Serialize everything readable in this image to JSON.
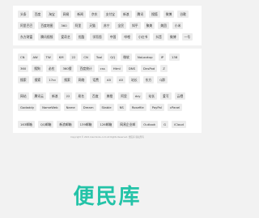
{
  "panels": [
    {
      "rows": [
        [
          "头条",
          "百度",
          "淘宝",
          "网易",
          "新闻",
          "京东",
          "支付宝",
          "新浪",
          "腾讯",
          "搜狐",
          "微博",
          "谷歌"
        ],
        [
          "阿里巴巴",
          "百度地图",
          "360",
          "阿里",
          "天猫",
          "苏宁",
          "全民",
          "知乎",
          "聚美",
          "美团",
          "小米"
        ],
        [
          "东方财富",
          "腾讯视频",
          "爱奇艺",
          "优酷",
          "学而思",
          "中国",
          "哔哩",
          "小红书",
          "抖音",
          "微博",
          "一号"
        ]
      ]
    },
    {
      "rows": [
        [
          "CN",
          "AW",
          "TW",
          "KM",
          "22",
          "CN",
          "Tool",
          "QQ",
          "微软",
          "NoLookup",
          "IP",
          "138"
        ],
        [
          "360",
          "搜狗",
          "必应",
          "360搜",
          "百度统计",
          "css",
          "Html",
          "DNS",
          "DnsPod",
          "Z"
        ],
        [
          "搜索",
          "搜索",
          "17cc",
          "搜索",
          "网络",
          "话费",
          "A5",
          "A5",
          "站长",
          "东方",
          "Q群"
        ]
      ]
    },
    {
      "rows": [
        [
          "网站",
          "腾讯云",
          "新浪",
          "22",
          "易名",
          "百度",
          "美橙",
          "阿里",
          "dzy",
          "站长",
          "爱写",
          "云栖"
        ],
        [
          "Godaddy",
          "NameWeb",
          "Name",
          "Dream",
          "Stable",
          "NS",
          "Rosefile",
          "PayPal",
          "cPanel"
        ]
      ]
    },
    {
      "rows": [
        [
          "163邮箱",
          "QQ邮箱",
          "新浪邮箱",
          "139邮箱",
          "126邮箱",
          "网易企业邮",
          "Outlook",
          "G",
          "iCloud"
        ]
      ]
    }
  ],
  "copyright": "Copyright © 2021 bianminku.com All Rights Reserved. 便民库 版权所有",
  "logo_text": "便民库"
}
